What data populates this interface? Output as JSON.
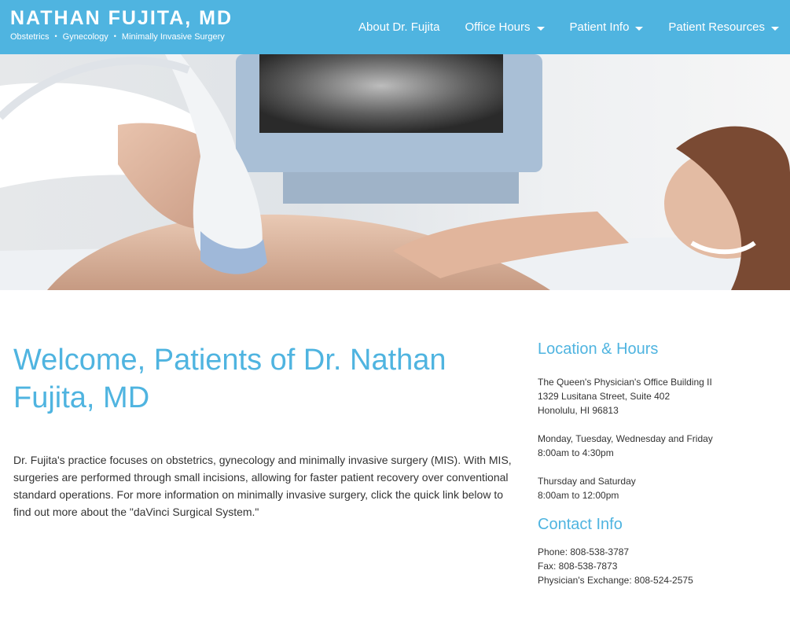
{
  "header": {
    "title": "NATHAN FUJITA, MD",
    "specialties": [
      "Obstetrics",
      "Gynecology",
      "Minimally Invasive Surgery"
    ],
    "separator": "•"
  },
  "nav": {
    "items": [
      {
        "label": "About Dr. Fujita",
        "has_dropdown": false
      },
      {
        "label": "Office Hours",
        "has_dropdown": true
      },
      {
        "label": "Patient Info",
        "has_dropdown": true
      },
      {
        "label": "Patient Resources",
        "has_dropdown": true
      }
    ]
  },
  "main": {
    "heading": "Welcome, Patients of Dr. Nathan Fujita, MD",
    "intro": "Dr. Fujita's practice focuses on obstetrics, gynecology and minimally invasive surgery (MIS). With MIS, surgeries are performed through small incisions, allowing for faster patient recovery over conventional standard operations. For more information on minimally invasive surgery, click the quick link below to find out more about the \"daVinci Surgical System.\""
  },
  "sidebar": {
    "location_heading": "Location & Hours",
    "address": [
      "The Queen's Physician's Office Building II",
      "1329 Lusitana Street, Suite 402",
      "Honolulu, HI 96813"
    ],
    "hours_weekday": [
      "Monday, Tuesday, Wednesday and Friday",
      "8:00am to 4:30pm"
    ],
    "hours_other": [
      "Thursday and Saturday",
      "8:00am to 12:00pm"
    ],
    "contact_heading": "Contact Info",
    "contact": [
      "Phone: 808-538-3787",
      "Fax: 808-538-7873",
      "Physician's Exchange: 808-524-2575"
    ]
  },
  "colors": {
    "brand": "#4fb4e0",
    "text": "#333333"
  }
}
